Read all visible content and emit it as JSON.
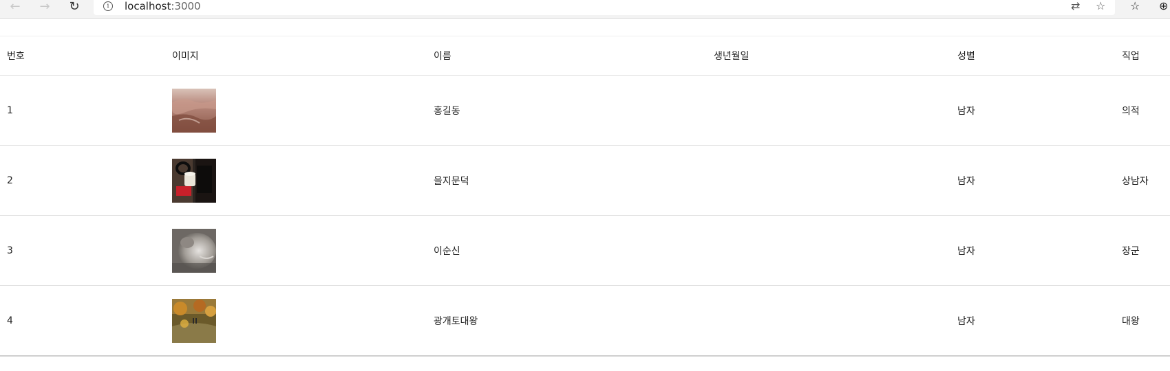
{
  "browser": {
    "back_icon": "back-arrow-icon",
    "forward_icon": "forward-arrow-icon",
    "refresh_icon": "refresh-icon",
    "url_host": "localhost",
    "url_port": ":3000"
  },
  "table": {
    "headers": {
      "num": "번호",
      "image": "이미지",
      "name": "이름",
      "birth": "생년월일",
      "gender": "성별",
      "job": "직업"
    },
    "rows": [
      {
        "num": "1",
        "image": "landscape-thumbnail",
        "name": "홍길동",
        "birth": "",
        "gender": "남자",
        "job": "의적"
      },
      {
        "num": "2",
        "image": "cup-thumbnail",
        "name": "을지문덕",
        "birth": "",
        "gender": "남자",
        "job": "상남자"
      },
      {
        "num": "3",
        "image": "cat-thumbnail",
        "name": "이순신",
        "birth": "",
        "gender": "남자",
        "job": "장군"
      },
      {
        "num": "4",
        "image": "autumn-thumbnail",
        "name": "광개토대왕",
        "birth": "",
        "gender": "남자",
        "job": "대왕"
      }
    ]
  }
}
